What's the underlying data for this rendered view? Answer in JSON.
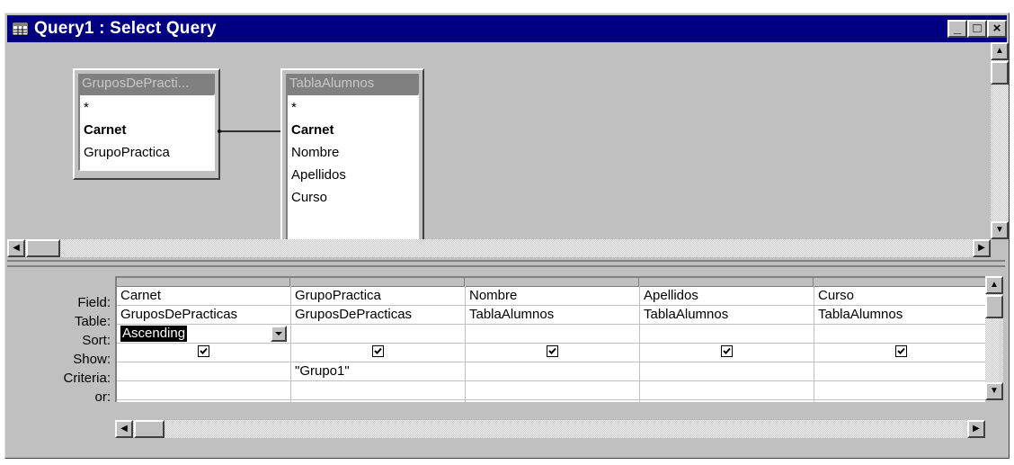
{
  "window": {
    "title": "Query1 : Select Query",
    "buttons": {
      "minimize": "_",
      "restore": "□",
      "close": "×"
    }
  },
  "design_pane": {
    "tables": [
      {
        "name": "GruposDePracti...",
        "fields": [
          "*",
          "Carnet",
          "GrupoPractica"
        ],
        "key_field": "Carnet"
      },
      {
        "name": "TablaAlumnos",
        "fields": [
          "*",
          "Carnet",
          "Nombre",
          "Apellidos",
          "Curso"
        ],
        "key_field": "Carnet"
      }
    ]
  },
  "grid": {
    "row_labels": [
      "Field:",
      "Table:",
      "Sort:",
      "Show:",
      "Criteria:",
      "or:"
    ],
    "columns": [
      {
        "field": "Carnet",
        "table": "GruposDePracticas",
        "sort": "Ascending",
        "show": true,
        "criteria": ""
      },
      {
        "field": "GrupoPractica",
        "table": "GruposDePracticas",
        "sort": "",
        "show": true,
        "criteria": "\"Grupo1\""
      },
      {
        "field": "Nombre",
        "table": "TablaAlumnos",
        "sort": "",
        "show": true,
        "criteria": ""
      },
      {
        "field": "Apellidos",
        "table": "TablaAlumnos",
        "sort": "",
        "show": true,
        "criteria": ""
      },
      {
        "field": "Curso",
        "table": "TablaAlumnos",
        "sort": "",
        "show": true,
        "criteria": ""
      }
    ]
  },
  "colors": {
    "titlebar": "#000080",
    "face": "#c0c0c0"
  }
}
